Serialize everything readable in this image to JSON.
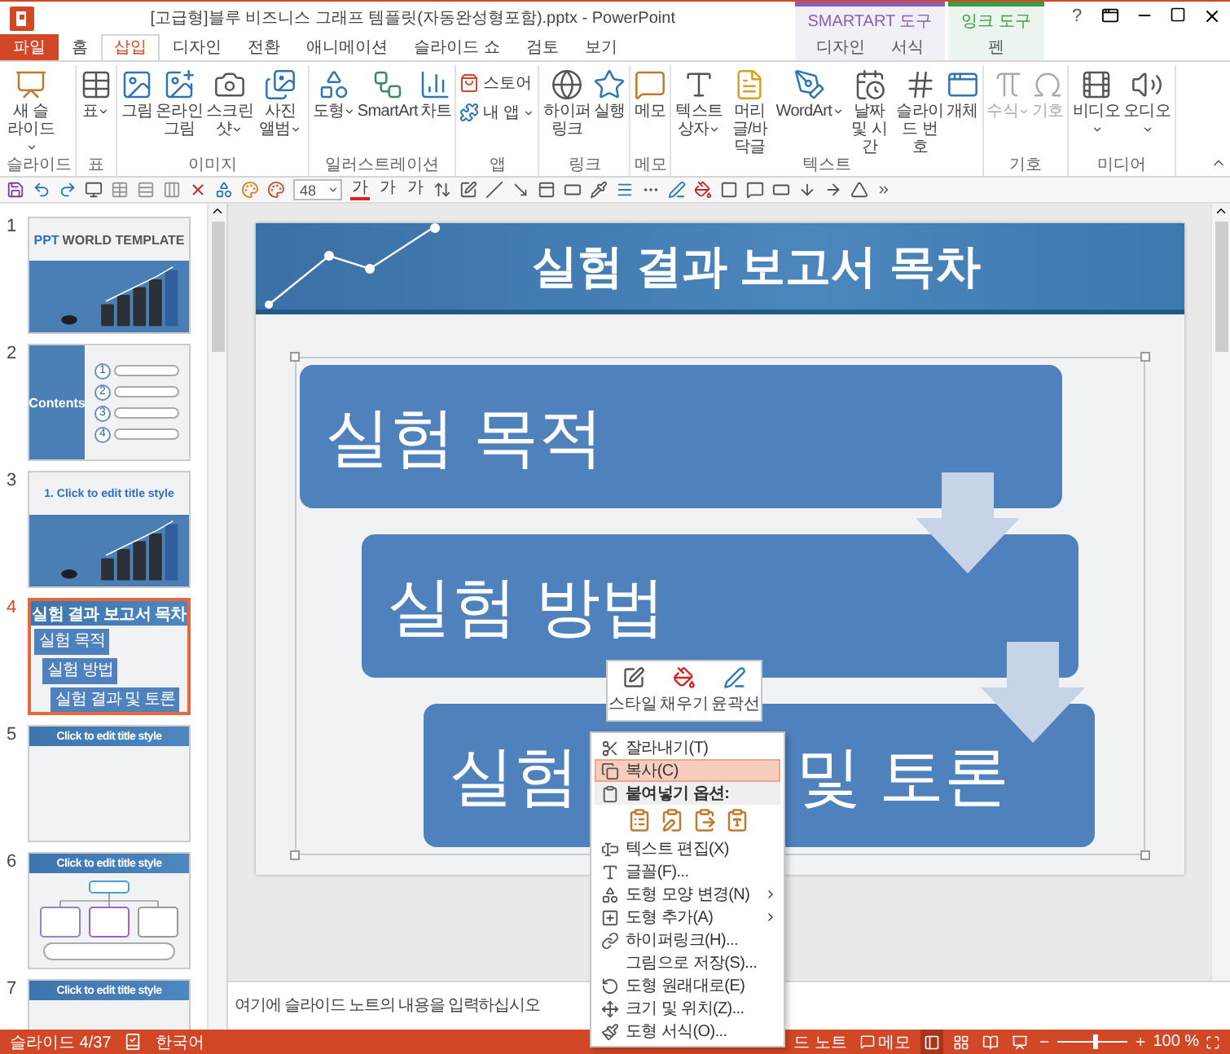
{
  "window": {
    "title": "[고급형]블루 비즈니스 그래프 템플릿(자동완성형포함).pptx - PowerPoint",
    "help": "?"
  },
  "tabs": [
    {
      "label": "파일",
      "kind": "file",
      "selected": false
    },
    {
      "label": "홈",
      "kind": "tab",
      "selected": false
    },
    {
      "label": "삽입",
      "kind": "tab",
      "selected": true
    },
    {
      "label": "디자인",
      "kind": "tab",
      "selected": false
    },
    {
      "label": "전환",
      "kind": "tab",
      "selected": false
    },
    {
      "label": "애니메이션",
      "kind": "tab",
      "selected": false
    },
    {
      "label": "슬라이드 쇼",
      "kind": "tab",
      "selected": false
    },
    {
      "label": "검토",
      "kind": "tab",
      "selected": false
    },
    {
      "label": "보기",
      "kind": "tab",
      "selected": false
    }
  ],
  "tool_headers": [
    {
      "label": "SMARTART 도구",
      "color": "#8a5fb3",
      "tabs": [
        {
          "label": "디자인",
          "selected": false
        },
        {
          "label": "서식",
          "selected": false
        }
      ]
    },
    {
      "label": "잉크 도구",
      "color": "#3f9b46",
      "tabs": [
        {
          "label": "펜",
          "selected": false
        }
      ]
    }
  ],
  "ribbon": [
    {
      "label": "슬라이드",
      "buttons": [
        {
          "label": "새 슬라이드",
          "kind": "slide",
          "dropdown": true,
          "disabled": false
        }
      ]
    },
    {
      "label": "표",
      "buttons": [
        {
          "label": "표",
          "kind": "table",
          "dropdown": true,
          "disabled": false
        }
      ]
    },
    {
      "label": "이미지",
      "buttons": [
        {
          "label": "그림",
          "kind": "picture",
          "dropdown": false,
          "disabled": false
        },
        {
          "label": "온라인 그림",
          "kind": "online_picture",
          "dropdown": false,
          "disabled": false
        },
        {
          "label": "스크린샷",
          "kind": "screenshot",
          "dropdown": true,
          "disabled": false
        },
        {
          "label": "사진 앨범",
          "kind": "album",
          "dropdown": true,
          "disabled": false
        }
      ]
    },
    {
      "label": "일러스트레이션",
      "buttons": [
        {
          "label": "도형",
          "kind": "shapes",
          "dropdown": true,
          "disabled": false
        },
        {
          "label": "SmartArt",
          "kind": "smartart",
          "dropdown": false,
          "disabled": false
        },
        {
          "label": "차트",
          "kind": "chart",
          "dropdown": false,
          "disabled": false
        }
      ]
    },
    {
      "label": "앱",
      "buttons": [
        {
          "label": "스토어",
          "kind": "store",
          "small": true,
          "dropdown": false,
          "disabled": false
        },
        {
          "label": "내 앱",
          "kind": "apps",
          "small": true,
          "dropdown": true,
          "disabled": false
        }
      ]
    },
    {
      "label": "링크",
      "buttons": [
        {
          "label": "하이퍼링크",
          "kind": "hyperlink",
          "dropdown": false,
          "disabled": false
        },
        {
          "label": "실행",
          "kind": "action",
          "dropdown": false,
          "disabled": false
        }
      ]
    },
    {
      "label": "메모",
      "buttons": [
        {
          "label": "메모",
          "kind": "comment",
          "dropdown": false,
          "disabled": false
        }
      ]
    },
    {
      "label": "텍스트",
      "buttons": [
        {
          "label": "텍스트 상자",
          "kind": "textbox",
          "dropdown": true,
          "disabled": false
        },
        {
          "label": "머리글/바닥글",
          "kind": "header",
          "dropdown": false,
          "disabled": false
        },
        {
          "label": "WordArt",
          "kind": "wordart",
          "dropdown": true,
          "disabled": false
        },
        {
          "label": "날짜 및 시간",
          "kind": "datetime",
          "dropdown": false,
          "disabled": false
        },
        {
          "label": "슬라이드 번호",
          "kind": "slidenumber",
          "dropdown": false,
          "disabled": false
        },
        {
          "label": "개체",
          "kind": "object",
          "dropdown": false,
          "disabled": false
        }
      ]
    },
    {
      "label": "기호",
      "buttons": [
        {
          "label": "수식",
          "kind": "equation",
          "dropdown": true,
          "disabled": true
        },
        {
          "label": "기호",
          "kind": "symbol",
          "dropdown": false,
          "disabled": true
        }
      ]
    },
    {
      "label": "미디어",
      "buttons": [
        {
          "label": "비디오",
          "kind": "video",
          "dropdown": true,
          "disabled": false
        },
        {
          "label": "오디오",
          "kind": "audio",
          "dropdown": true,
          "disabled": false
        }
      ]
    }
  ],
  "quick_toolbar": {
    "font_size": "48",
    "font_color_glyph": "가",
    "grow_glyph": "가",
    "shrink_glyph": "가"
  },
  "slides": [
    {
      "number": "1",
      "kind": "title",
      "selected": false,
      "title_accent": "PPT",
      "title": "WORLD TEMPLATE"
    },
    {
      "number": "2",
      "kind": "contents",
      "selected": false,
      "title": "Contents",
      "items": [
        "1",
        "2",
        "3",
        "4"
      ]
    },
    {
      "number": "3",
      "kind": "section",
      "selected": false,
      "title": "1. Click to edit title style"
    },
    {
      "number": "4",
      "kind": "toc",
      "selected": true,
      "title": "실험 결과 보고서 목차",
      "items": [
        "실험 목적",
        "실험 방법",
        "실험 결과 및 토론"
      ]
    },
    {
      "number": "5",
      "kind": "blank",
      "selected": false,
      "title": "Click to edit title style"
    },
    {
      "number": "6",
      "kind": "diagram",
      "selected": false,
      "title": "Click to edit title style"
    },
    {
      "number": "7",
      "kind": "blank",
      "selected": false,
      "title": "Click to edit title style"
    }
  ],
  "slide": {
    "title": "실험 결과 보고서 목차",
    "steps": [
      {
        "parts": [
          "실험 목적"
        ]
      },
      {
        "parts": [
          "실험 방법"
        ]
      },
      {
        "parts": [
          "실험",
          "및 토론"
        ]
      }
    ]
  },
  "notes": {
    "placeholder": "여기에 슬라이드 노트의 내용을 입력하십시오"
  },
  "mini_toolbar": [
    {
      "label": "스타일",
      "kind": "style"
    },
    {
      "label": "채우기",
      "kind": "fill"
    },
    {
      "label": "윤곽선",
      "kind": "outline"
    }
  ],
  "context_menu": [
    {
      "label": "잘라내기(T)",
      "kind": "cut",
      "selected": false
    },
    {
      "label": "복사(C)",
      "kind": "copy",
      "selected": true
    },
    {
      "label": "붙여넣기 옵션:",
      "kind": "header"
    },
    {
      "kind": "paste"
    },
    {
      "label": "텍스트 편집(X)",
      "kind": "edit_text",
      "selected": false
    },
    {
      "label": "글꼴(F)...",
      "kind": "font",
      "selected": false
    },
    {
      "label": "도형 모양 변경(N)",
      "kind": "change_shape",
      "submenu": true,
      "selected": false
    },
    {
      "label": "도형 추가(A)",
      "kind": "add_shape",
      "submenu": true,
      "selected": false
    },
    {
      "label": "하이퍼링크(H)...",
      "kind": "link",
      "selected": false
    },
    {
      "label": "그림으로 저장(S)...",
      "kind": "none",
      "selected": false
    },
    {
      "label": "도형 원래대로(E)",
      "kind": "reset",
      "selected": false
    },
    {
      "label": "크기 및 위치(Z)...",
      "kind": "size",
      "selected": false
    },
    {
      "label": "도형 서식(O)...",
      "kind": "format",
      "selected": false
    }
  ],
  "status": {
    "slide_info": "슬라이드 4/37",
    "language": "한국어",
    "notes": "드 노트",
    "comments": "메모",
    "views": [
      {
        "kind": "normal",
        "selected": true
      },
      {
        "kind": "sorter",
        "selected": false
      },
      {
        "kind": "reading",
        "selected": false
      },
      {
        "kind": "show",
        "selected": false
      }
    ],
    "zoom": {
      "label": "100 %",
      "level": 0.55
    }
  }
}
